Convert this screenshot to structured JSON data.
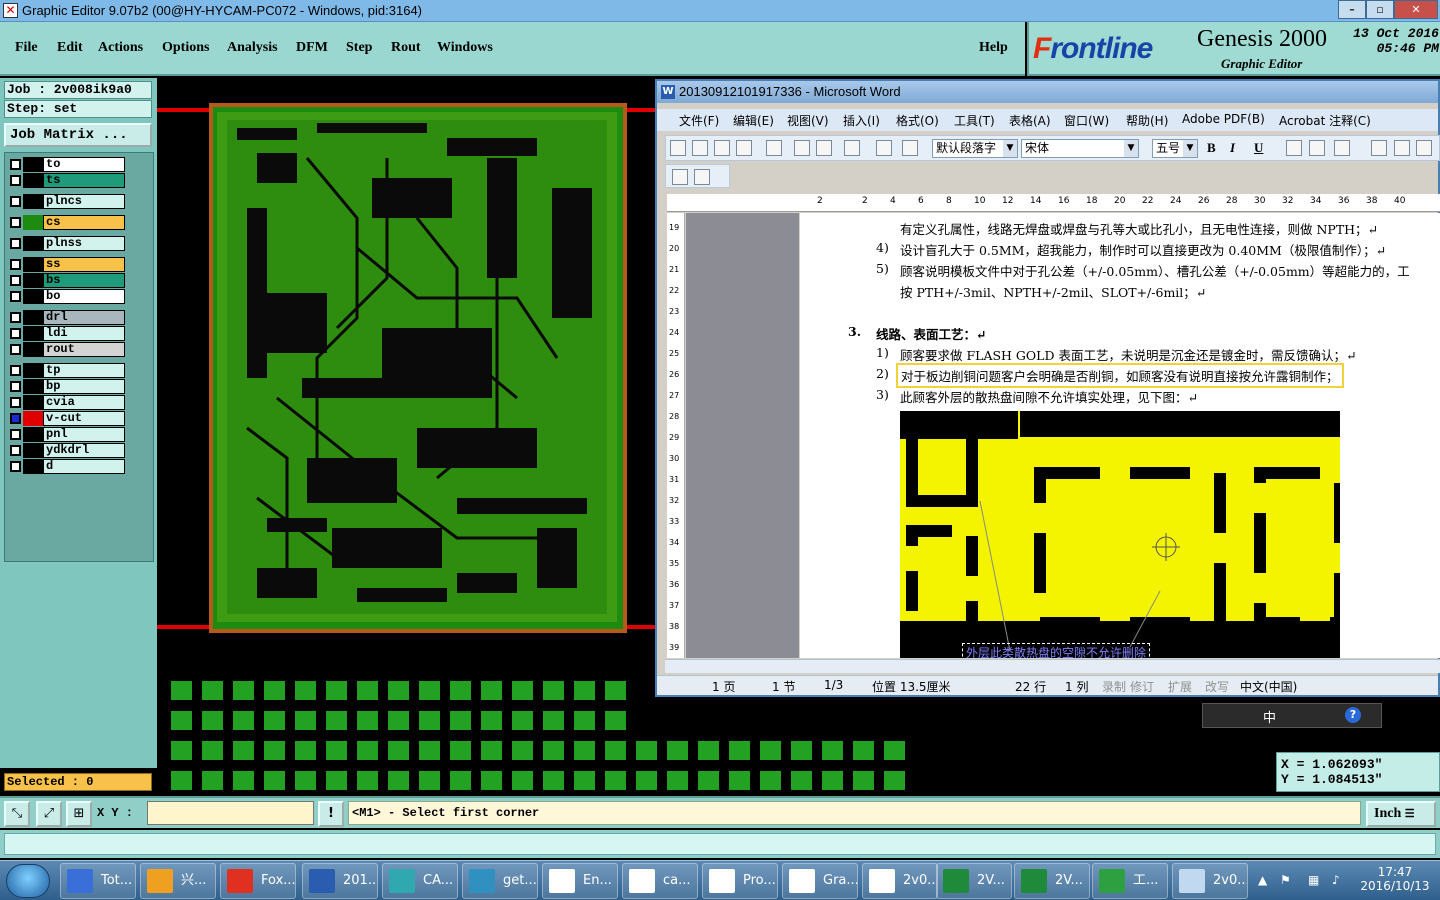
{
  "window": {
    "title": "Graphic Editor 9.07b2 (00@HY-HYCAM-PC072 - Windows, pid:3164)"
  },
  "menu": {
    "items": [
      "File",
      "Edit",
      "Actions",
      "Options",
      "Analysis",
      "DFM",
      "Step",
      "Rout",
      "Windows"
    ],
    "help": "Help"
  },
  "brand": {
    "logo_f": "F",
    "logo_rest": "rontline",
    "product": "Genesis 2000",
    "subtitle": "Graphic Editor",
    "date": "13 Oct 2016",
    "time": "05:46 PM"
  },
  "panel": {
    "job": "Job : 2v008ik9a0",
    "step": "Step: set",
    "job_matrix": "Job Matrix ...",
    "layers": [
      {
        "name": "to",
        "color": "#ffffff"
      },
      {
        "name": "ts",
        "color": "#1f9a7a"
      },
      {
        "name": "plncs",
        "color": "#d2f2ee"
      },
      {
        "name": "cs",
        "color": "#f7c14a"
      },
      {
        "name": "plnss",
        "color": "#d2f2ee"
      },
      {
        "name": "ss",
        "color": "#f7c14a"
      },
      {
        "name": "bs",
        "color": "#1f9a7a"
      },
      {
        "name": "bo",
        "color": "#ffffff"
      },
      {
        "name": "drl",
        "color": "#a9b6bd"
      },
      {
        "name": "ldi",
        "color": "#d2f2ee"
      },
      {
        "name": "rout",
        "color": "#d4d4d4"
      },
      {
        "name": "tp",
        "color": "#d2f2ee"
      },
      {
        "name": "bp",
        "color": "#d2f2ee"
      },
      {
        "name": "cvia",
        "color": "#d2f2ee"
      },
      {
        "name": "v-cut",
        "color": "#d2f2ee"
      },
      {
        "name": "pnl",
        "color": "#d2f2ee"
      },
      {
        "name": "ydkdrl",
        "color": "#d2f2ee"
      },
      {
        "name": "d",
        "color": "#d2f2ee"
      }
    ],
    "selected": "Selected : 0"
  },
  "word": {
    "title": "20130912101917336 - Microsoft Word",
    "menu": [
      "文件(F)",
      "编辑(E)",
      "视图(V)",
      "插入(I)",
      "格式(O)",
      "工具(T)",
      "表格(A)",
      "窗口(W)",
      "帮助(H)",
      "Adobe PDF(B)",
      "Acrobat 注释(C)"
    ],
    "style": "默认段落字",
    "font": "宋体",
    "size": "五号",
    "ruler": [
      "2",
      "2",
      "4",
      "6",
      "8",
      "10",
      "12",
      "14",
      "16",
      "18",
      "20",
      "22",
      "24",
      "26",
      "28",
      "30",
      "32",
      "34",
      "36",
      "38",
      "40"
    ],
    "vruler": [
      "19",
      "20",
      "21",
      "22",
      "23",
      "24",
      "25",
      "26",
      "27",
      "28",
      "29",
      "30",
      "31",
      "32",
      "33",
      "34",
      "35",
      "36",
      "37",
      "38",
      "39"
    ],
    "lines": [
      "有定义孔属性，线路无焊盘或焊盘与孔等大或比孔小，且无电性连接，则做 NPTH；↵",
      "设计盲孔大于 0.5MM，超我能力，制作时可以直接更改为 0.40MM（极限值制作）；↵",
      "顾客说明模板文件中对于孔公差（+/-0.05mm）、槽孔公差（+/-0.05mm）等超能力的，工",
      "按 PTH+/-3mil、NPTH+/-2mil、SLOT+/-6mil；↵",
      "线路、表面工艺：↵",
      "顾客要求做 FLASH GOLD 表面工艺，未说明是沉金还是镀金时，需反馈确认；↵",
      "对于板边削铜问题客户会明确是否削铜，如顾客没有说明直接按允许露铜制作；",
      "此顾客外层的散热盘间隙不允许填实处理，见下图：↵"
    ],
    "nums": [
      "4)",
      "5)",
      "3.",
      "1)",
      "2)",
      "3)"
    ],
    "image_caption": "外层此类散热盘的空隙不允许删除",
    "status": [
      "1 页",
      "1 节",
      "1/3",
      "位置 13.5厘米",
      "22 行",
      "1 列",
      "录制",
      "修订",
      "扩展",
      "改写",
      "中文(中国)"
    ]
  },
  "ime": {
    "text": "中"
  },
  "coords": {
    "x": "X = 1.062093\"",
    "y": "Y = 1.084513\""
  },
  "cmd": {
    "xy_label": "X Y :",
    "xy_value": "",
    "prompt": "<M1> - Select first corner",
    "units": "Inch"
  },
  "taskbar": {
    "items": [
      {
        "label": "Tot...",
        "color": "#3a6fd8"
      },
      {
        "label": "兴...",
        "color": "#f0a020"
      },
      {
        "label": "Fox...",
        "color": "#e03020"
      },
      {
        "label": "201...",
        "color": "#2a5db0"
      },
      {
        "label": "CA...",
        "color": "#30a8b0"
      },
      {
        "label": "get...",
        "color": "#3090c0"
      },
      {
        "label": "En...",
        "color": "#ffffff"
      },
      {
        "label": "ca...",
        "color": "#ffffff"
      },
      {
        "label": "Pro...",
        "color": "#ffffff"
      },
      {
        "label": "Gra...",
        "color": "#ffffff"
      },
      {
        "label": "2v0...",
        "color": "#ffffff"
      },
      {
        "label": "2V...",
        "color": "#1f8a3a"
      },
      {
        "label": "2V...",
        "color": "#1f8a3a"
      },
      {
        "label": "工...",
        "color": "#2fa040"
      },
      {
        "label": "2v0...",
        "color": "#c0d8f0"
      }
    ],
    "time": "17:47",
    "date": "2016/10/13"
  }
}
